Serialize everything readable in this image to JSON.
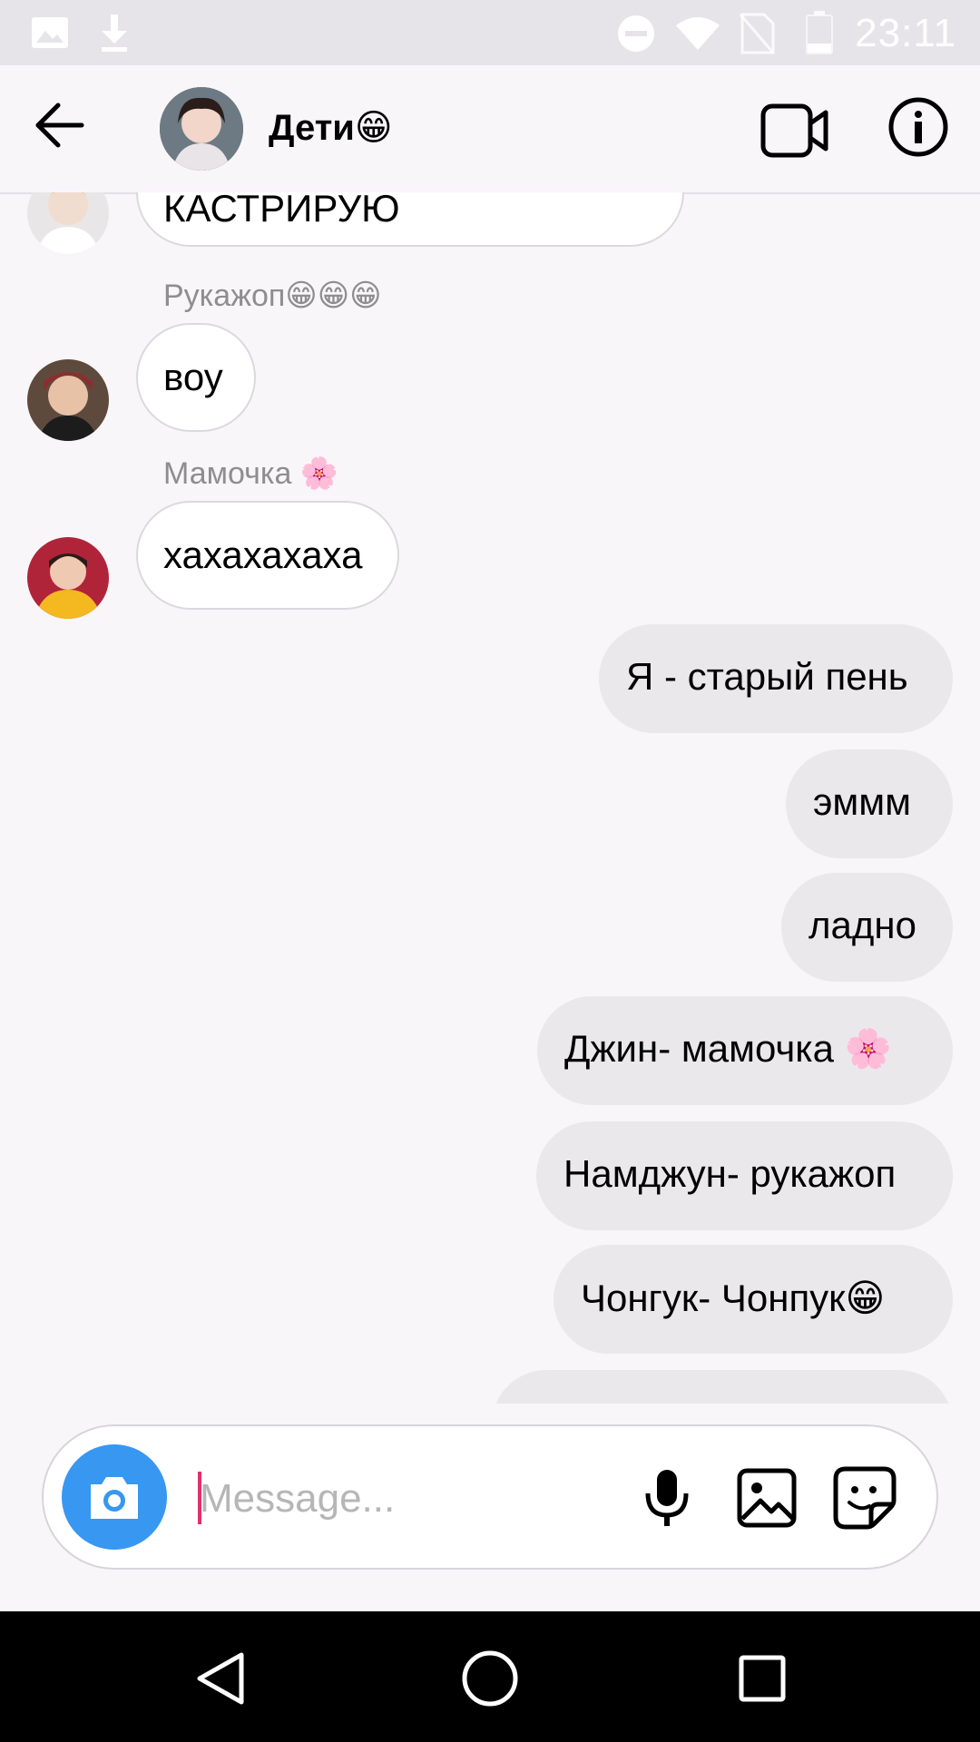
{
  "status_bar": {
    "time": "23:11"
  },
  "header": {
    "title": "Дети😁"
  },
  "messages": {
    "m1": {
      "text": "КАСТРИРУЮ"
    },
    "m2": {
      "sender": "Рукажоп😁😁😁",
      "text": "воу"
    },
    "m3": {
      "sender": "Мамочка 🌸",
      "text": "хахахахаха"
    },
    "m4": {
      "text": "Я - старый пень"
    },
    "m5": {
      "text": "эммм"
    },
    "m6": {
      "text": "ладно"
    },
    "m7": {
      "text": "Джин- мамочка 🌸"
    },
    "m8": {
      "text": "Намджун- рукажоп"
    },
    "m9": {
      "text": "Чонгук- Чонпук😁"
    }
  },
  "composer": {
    "placeholder": "Message..."
  },
  "colors": {
    "accent": "#3897f0",
    "caret": "#e1306c"
  }
}
